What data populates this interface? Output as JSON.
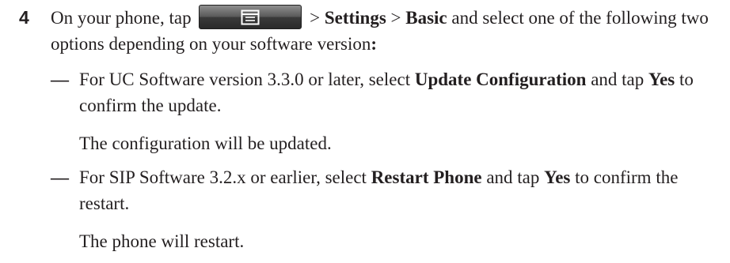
{
  "step": {
    "number": "4",
    "intro_before": "On your phone, tap",
    "intro_after": "> ",
    "settings": "Settings",
    "sep": " > ",
    "basic": "Basic",
    "intro_tail": " and select one of the following two options depending on your software version",
    "colon": ":",
    "menu_icon": "menu-icon"
  },
  "options": [
    {
      "dash": "—",
      "text_a": "For UC Software version 3.3.0 or later, select ",
      "bold_a": "Update Configuration",
      "text_b": " and tap ",
      "bold_b": "Yes",
      "text_c": " to confirm the update.",
      "result": "The configuration will be updated."
    },
    {
      "dash": "—",
      "text_a": "For SIP Software 3.2.x or earlier, select ",
      "bold_a": "Restart Phone",
      "text_b": " and tap ",
      "bold_b": "Yes",
      "text_c": " to confirm the restart.",
      "result": "The phone will restart."
    }
  ]
}
